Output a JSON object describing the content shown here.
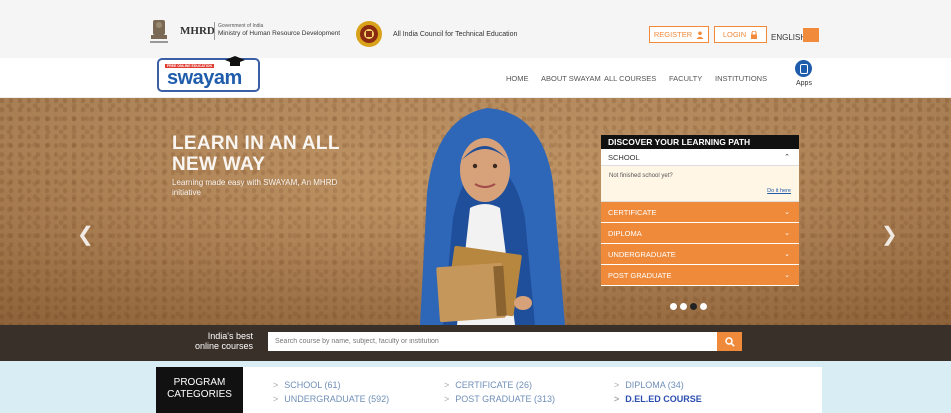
{
  "topbar": {
    "mhrd_title": "MHRD",
    "mhrd_gov": "Government of India",
    "mhrd_ministry": "Ministry of Human Resource Development",
    "aicte_text": "All India Council for Technical Education",
    "register_label": "REGISTER",
    "login_label": "LOGIN",
    "language": "ENGLISH"
  },
  "nav": {
    "logo_tag": "FREE ONLINE EDUCATION",
    "logo_word": "swayam",
    "items": [
      "HOME",
      "ABOUT SWAYAM",
      "ALL COURSES",
      "FACULTY",
      "INSTITUTIONS"
    ],
    "apps_label": "Apps"
  },
  "hero": {
    "title": "LEARN IN AN ALL NEW WAY",
    "subtitle": "Learning made easy with SWAYAM, An MHRD initiative"
  },
  "discover": {
    "heading": "DISCOVER YOUR LEARNING PATH",
    "open_item": "SCHOOL",
    "open_text": "Not finished school yet?",
    "open_link": "Do it here",
    "items": [
      "CERTIFICATE",
      "DIPLOMA",
      "UNDERGRADUATE",
      "POST GRADUATE"
    ]
  },
  "carousel": {
    "slide_count": 4,
    "active_slide": 3
  },
  "search": {
    "label_line1": "India's best",
    "label_line2": "online courses",
    "placeholder": "Search course by name, subject, faculty or institution"
  },
  "program": {
    "label_line1": "PROGRAM",
    "label_line2": "CATEGORIES",
    "links": [
      "SCHOOL (61)",
      "CERTIFICATE (26)",
      "DIPLOMA (34)",
      "UNDERGRADUATE (592)",
      "POST GRADUATE (313)",
      "D.EL.ED COURSE"
    ]
  },
  "colors": {
    "accent": "#ee8a3a",
    "brand_blue": "#1f5cab",
    "dark": "#111111",
    "program_bg": "#d9eef4"
  }
}
